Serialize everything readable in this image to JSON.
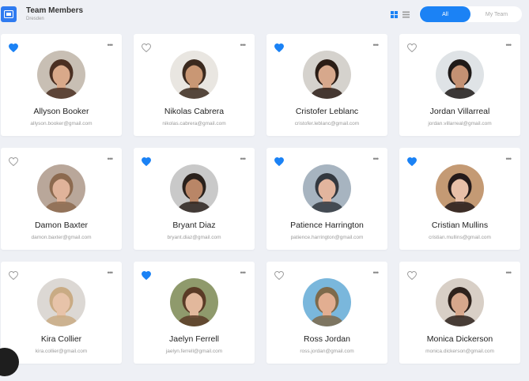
{
  "header": {
    "title": "Team Members",
    "subtitle": "Dresden",
    "tabs": [
      {
        "label": "All",
        "active": true
      },
      {
        "label": "My Team",
        "active": false
      }
    ],
    "accent": "#1b82f5"
  },
  "members": [
    {
      "name": "Allyson Booker",
      "email": "allyson.booker@gmail.com",
      "favorite": true,
      "bg": "#c8bfb4",
      "skin": "#d9a98a",
      "hair": "#4a2f22"
    },
    {
      "name": "Nikolas Cabrera",
      "email": "nikolas.cabrera@gmail.com",
      "favorite": false,
      "bg": "#e9e6e1",
      "skin": "#c99774",
      "hair": "#3b2a1f"
    },
    {
      "name": "Cristofer Leblanc",
      "email": "cristofer.leblanc@gmail.com",
      "favorite": true,
      "bg": "#d5d2cd",
      "skin": "#d7a88c",
      "hair": "#2b1d16"
    },
    {
      "name": "Jordan Villarreal",
      "email": "jordan.villarreal@gmail.com",
      "favorite": false,
      "bg": "#dfe3e6",
      "skin": "#c49173",
      "hair": "#1f1a18"
    },
    {
      "name": "Damon Baxter",
      "email": "damon.baxter@gmail.com",
      "favorite": false,
      "bg": "#b9a79a",
      "skin": "#e0b39a",
      "hair": "#8c6a4f"
    },
    {
      "name": "Bryant Diaz",
      "email": "bryant.diaz@gmail.com",
      "favorite": true,
      "bg": "#c9c9c9",
      "skin": "#b98667",
      "hair": "#2a211c"
    },
    {
      "name": "Patience Harrington",
      "email": "patience.harrington@gmail.com",
      "favorite": true,
      "bg": "#a7b4c0",
      "skin": "#e2b59e",
      "hair": "#33383f"
    },
    {
      "name": "Cristian Mullins",
      "email": "cristian.mullins@gmail.com",
      "favorite": true,
      "bg": "#c49a74",
      "skin": "#e8bfa8",
      "hair": "#241a1a"
    },
    {
      "name": "Kira Collier",
      "email": "kira.collier@gmail.com",
      "favorite": false,
      "bg": "#dcd8d4",
      "skin": "#e7c3a9",
      "hair": "#c9ab84"
    },
    {
      "name": "Jaelyn Ferrell",
      "email": "jaelyn.ferrell@gmail.com",
      "favorite": true,
      "bg": "#8f9a6c",
      "skin": "#e2b89c",
      "hair": "#5a3b26"
    },
    {
      "name": "Ross Jordan",
      "email": "ross.jordan@gmail.com",
      "favorite": false,
      "bg": "#7ab7dc",
      "skin": "#e2ae91",
      "hair": "#7e6a4b"
    },
    {
      "name": "Monica Dickerson",
      "email": "monica.dickerson@gmail.com",
      "favorite": false,
      "bg": "#d8cfc6",
      "skin": "#d6a78c",
      "hair": "#2e221c"
    }
  ]
}
